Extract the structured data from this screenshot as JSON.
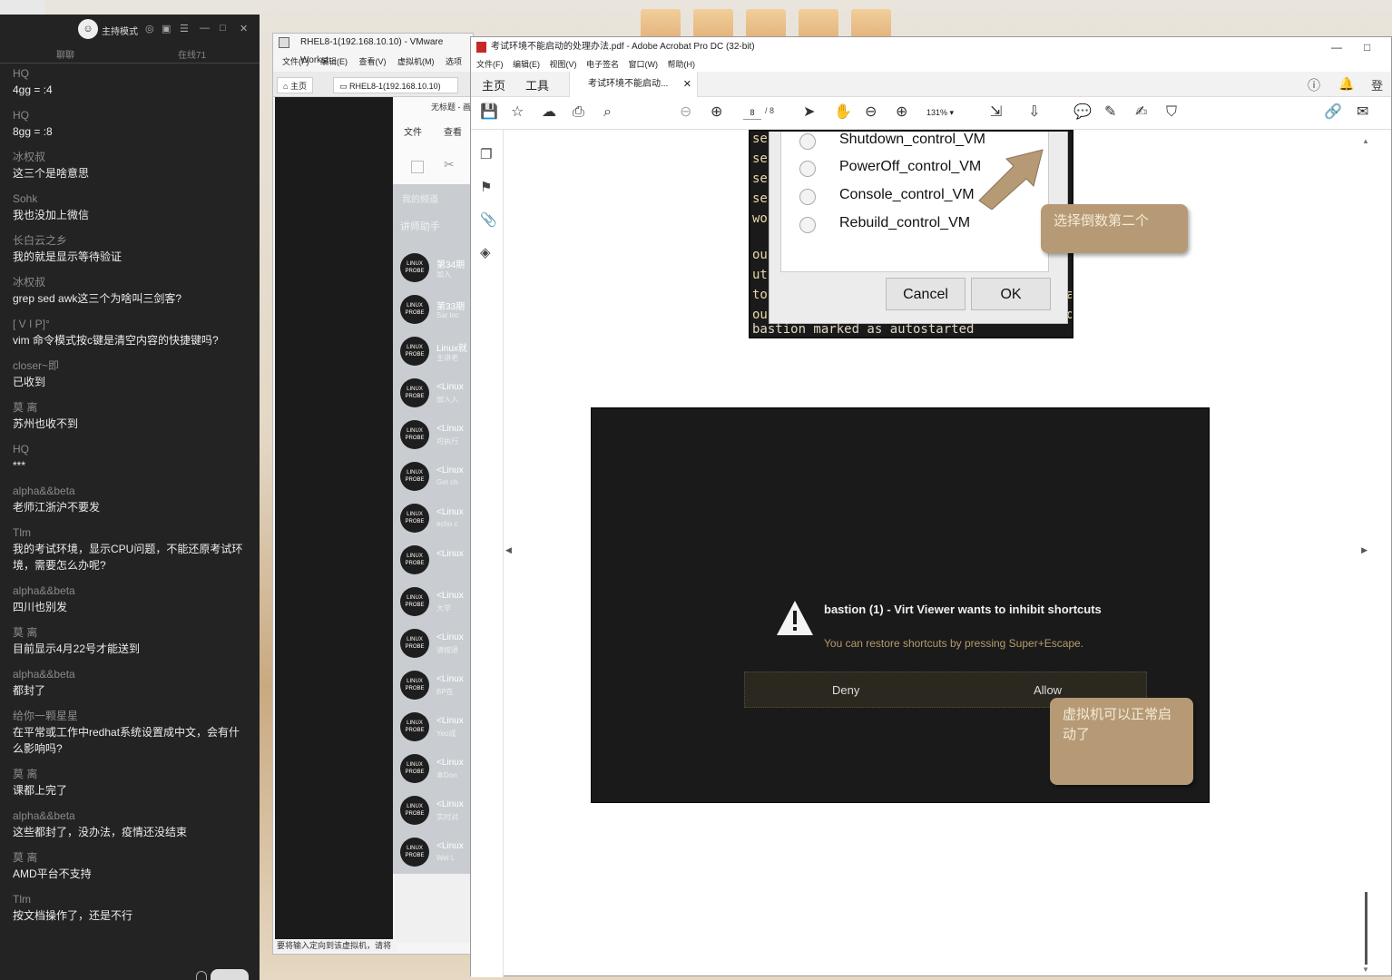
{
  "chat": {
    "mode_label": "主持模式",
    "tabs": [
      "聊聊",
      "在线71"
    ],
    "messages": [
      {
        "name": "HQ",
        "text": "4gg = :4"
      },
      {
        "name": "HQ",
        "text": "8gg = :8"
      },
      {
        "name": "冰权叔",
        "text": "这三个是啥意思"
      },
      {
        "name": "Sohk",
        "text": "我也没加上微信"
      },
      {
        "name": "长白云之乡",
        "text": "我的就是显示等待验证"
      },
      {
        "name": "冰权叔",
        "text": "grep  sed    awk这三个为啥叫三剑客?"
      },
      {
        "name": "[     V      I      P]°",
        "text": "vim 命令模式按c键是清空内容的快捷键吗?"
      },
      {
        "name": "closer~即",
        "text": "已收到"
      },
      {
        "name": "莫 离",
        "text": "苏州也收不到"
      },
      {
        "name": "HQ",
        "text": "***"
      },
      {
        "name": "alpha&&beta",
        "text": "老师江浙沪不要发"
      },
      {
        "name": "Tlm",
        "text": "我的考试环境，显示CPU问题，不能还原考试环境，需要怎么办呢?"
      },
      {
        "name": "alpha&&beta",
        "text": "四川也别发"
      },
      {
        "name": "莫 离",
        "text": "目前显示4月22号才能送到"
      },
      {
        "name": "alpha&&beta",
        "text": "都封了"
      },
      {
        "name": "给你一颗星星",
        "text": "在平常或工作中redhat系统设置成中文，会有什么影响吗?"
      },
      {
        "name": "莫 离",
        "text": "课都上完了"
      },
      {
        "name": "alpha&&beta",
        "text": "这些都封了，没办法，疫情还没结束"
      },
      {
        "name": "莫 离",
        "text": "AMD平台不支持"
      },
      {
        "name": "Tlm",
        "text": "按文档操作了，还是不行"
      }
    ]
  },
  "vmware": {
    "title": "RHEL8-1(192.168.10.10) - VMware Workst",
    "menu": "文件(F) 编辑(E) 查看(V) 虚拟机(M) 选项",
    "tab_home": "主页",
    "tab_vm": "RHEL8-1(192.168.10.10)",
    "status": "要将输入定向到该虚拟机，请将",
    "inner": {
      "title": "无标题 - 画",
      "menu_file": "文件",
      "menu_view": "查看",
      "list_header1": "我的频道",
      "list_header2": "讲师助手",
      "logo_text": "LINUX PROBE",
      "items": [
        {
          "title": "第34期",
          "sub": "加入"
        },
        {
          "title": "第33期",
          "sub": "Sar loc"
        },
        {
          "title": "Linux就",
          "sub": "主讲老"
        },
        {
          "title": "<Linux",
          "sub": "加入入"
        },
        {
          "title": "<Linux",
          "sub": "可执行"
        },
        {
          "title": "<Linux",
          "sub": "Get ch"
        },
        {
          "title": "<Linux",
          "sub": "echo c"
        },
        {
          "title": "<Linux",
          "sub": ""
        },
        {
          "title": "<Linux",
          "sub": "大学"
        },
        {
          "title": "<Linux",
          "sub": "请按退"
        },
        {
          "title": "<Linux",
          "sub": "BP在"
        },
        {
          "title": "<Linux",
          "sub": "Yeo成"
        },
        {
          "title": "<Linux",
          "sub": "本Don"
        },
        {
          "title": "<Linux",
          "sub": "实时对"
        },
        {
          "title": "<Linux",
          "sub": "Wel L"
        }
      ]
    }
  },
  "acrobat": {
    "title": "考试环境不能启动的处理办法.pdf - Adobe Acrobat Pro DC (32-bit)",
    "menu": "文件(F) 编辑(E) 视图(V) 电子签名 窗口(W) 帮助(H)",
    "tab_home": "主页",
    "tab_tools": "工具",
    "doc_tab": "考试环境不能启动...",
    "login": "登录",
    "page_current": "8",
    "page_total": "/ 8",
    "zoom": "131%",
    "dialog": {
      "options": [
        "Shutdown_control_VM",
        "PowerOff_control_VM",
        "Console_control_VM",
        "Rebuild_control_VM"
      ],
      "cancel": "Cancel",
      "ok": "OK",
      "terminal_left": [
        "se",
        "se",
        "se",
        "se",
        "wo",
        "",
        "ou",
        "ut",
        "to",
        "ou"
      ],
      "terminal_right": [
        "c",
        "c",
        "c",
        "c",
        "",
        "",
        "",
        "",
        "ea",
        "id"
      ],
      "bastion_line": "bastion marked as autostarted",
      "callout": "选择倒数第二个"
    },
    "inhibit": {
      "title": "bastion (1) - Virt Viewer wants to inhibit shortcuts",
      "subtitle": "You can restore shortcuts by pressing Super+Escape.",
      "deny": "Deny",
      "allow": "Allow",
      "callout": "虚拟机可以正常启动了"
    }
  }
}
